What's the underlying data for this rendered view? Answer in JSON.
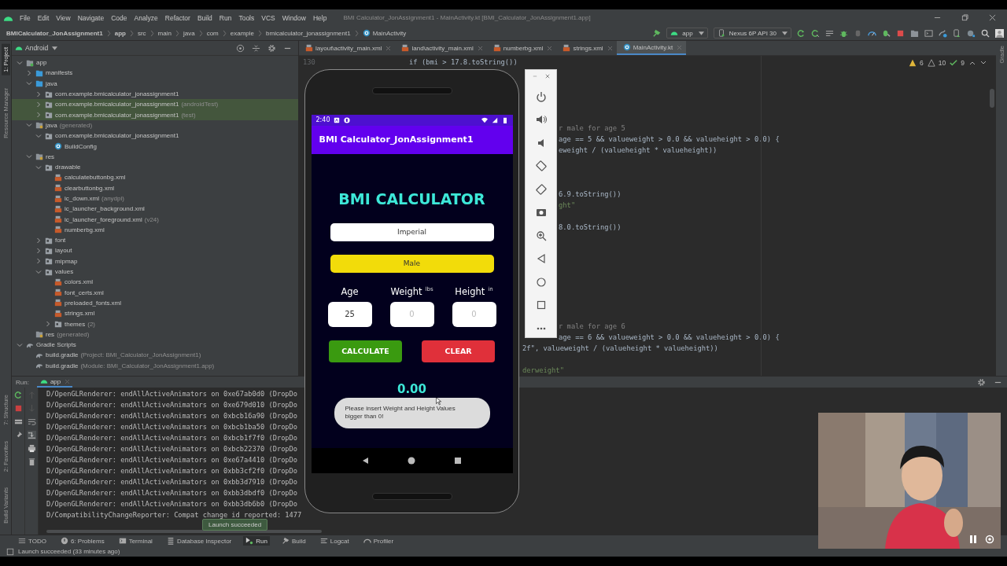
{
  "menu_bar": {
    "items": [
      "File",
      "Edit",
      "View",
      "Navigate",
      "Code",
      "Analyze",
      "Refactor",
      "Build",
      "Run",
      "Tools",
      "VCS",
      "Window",
      "Help"
    ],
    "title": "BMI Calculator_JonAssignment1 - MainActivity.kt [BMI_Calculator_JonAssignment1.app]"
  },
  "nav_bar": {
    "breadcrumbs": [
      {
        "label": "BMICalculator_JonAssignment1",
        "kind": "project"
      },
      {
        "label": "app",
        "kind": "module"
      },
      {
        "label": "src",
        "kind": "dir"
      },
      {
        "label": "main",
        "kind": "dir"
      },
      {
        "label": "java",
        "kind": "dir"
      },
      {
        "label": "com",
        "kind": "dir"
      },
      {
        "label": "example",
        "kind": "dir"
      },
      {
        "label": "bmicalculator_jonassignment1",
        "kind": "dir"
      },
      {
        "label": "MainActivity",
        "kind": "class"
      }
    ],
    "run_config": "app",
    "device": "Nexus 6P API 30"
  },
  "left_tool_strip": {
    "top": [
      {
        "label": "1: Project",
        "selected": true
      },
      {
        "label": "Resource Manager",
        "selected": false
      }
    ],
    "bottom": [
      {
        "label": "7: Structure",
        "selected": false
      },
      {
        "label": "2: Favorites",
        "selected": false
      },
      {
        "label": "Build Variants",
        "selected": false
      }
    ]
  },
  "right_tool_strip": [
    {
      "label": "Gradle",
      "selected": false
    }
  ],
  "project": {
    "view": "Android",
    "tree": [
      {
        "label": "app",
        "kind": "module",
        "expanded": true,
        "selected": false,
        "children": [
          {
            "label": "manifests",
            "kind": "source",
            "expanded": false,
            "selected": false
          },
          {
            "label": "java",
            "kind": "source",
            "expanded": true,
            "selected": false,
            "children": [
              {
                "label": "com.example.bmicalculator_jonassignment1",
                "kind": "package",
                "expanded": false,
                "selected": false
              },
              {
                "label": "com.example.bmicalculator_jonassignment1",
                "note": "(androidTest)",
                "kind": "package",
                "expanded": false,
                "selected": true
              },
              {
                "label": "com.example.bmicalculator_jonassignment1",
                "note": "(test)",
                "kind": "package",
                "expanded": false,
                "selected": true
              }
            ]
          },
          {
            "label": "java",
            "note": "(generated)",
            "kind": "generated",
            "expanded": true,
            "selected": false,
            "children": [
              {
                "label": "com.example.bmicalculator_jonassignment1",
                "kind": "package",
                "expanded": true,
                "selected": false,
                "children": [
                  {
                    "label": "BuildConfig",
                    "kind": "class",
                    "selected": false
                  }
                ]
              }
            ]
          },
          {
            "label": "res",
            "kind": "resources",
            "expanded": true,
            "selected": false,
            "children": [
              {
                "label": "drawable",
                "kind": "package",
                "expanded": true,
                "selected": false,
                "children": [
                  {
                    "label": "calculatebuttonbg.xml",
                    "kind": "xml",
                    "selected": false
                  },
                  {
                    "label": "clearbuttonbg.xml",
                    "kind": "xml",
                    "selected": false
                  },
                  {
                    "label": "ic_down.xml",
                    "note": "(anydpi)",
                    "kind": "xml",
                    "selected": false
                  },
                  {
                    "label": "ic_launcher_background.xml",
                    "kind": "xml",
                    "selected": false
                  },
                  {
                    "label": "ic_launcher_foreground.xml",
                    "note": "(v24)",
                    "kind": "xml",
                    "selected": false
                  },
                  {
                    "label": "numberbg.xml",
                    "kind": "xml",
                    "selected": false
                  }
                ]
              },
              {
                "label": "font",
                "kind": "package",
                "expanded": false,
                "selected": false
              },
              {
                "label": "layout",
                "kind": "package",
                "expanded": false,
                "selected": false
              },
              {
                "label": "mipmap",
                "kind": "package",
                "expanded": false,
                "selected": false
              },
              {
                "label": "values",
                "kind": "package",
                "expanded": true,
                "selected": false,
                "children": [
                  {
                    "label": "colors.xml",
                    "kind": "xml",
                    "selected": false
                  },
                  {
                    "label": "font_certs.xml",
                    "kind": "xml",
                    "selected": false
                  },
                  {
                    "label": "preloaded_fonts.xml",
                    "kind": "xml",
                    "selected": false
                  },
                  {
                    "label": "strings.xml",
                    "kind": "xml",
                    "selected": false
                  },
                  {
                    "label": "themes",
                    "note": "(2)",
                    "kind": "package",
                    "expanded": false,
                    "selected": false
                  }
                ]
              }
            ]
          },
          {
            "label": "res",
            "note": "(generated)",
            "kind": "resources",
            "selected": false
          }
        ]
      },
      {
        "label": "Gradle Scripts",
        "kind": "gradle",
        "expanded": true,
        "selected": false,
        "children": [
          {
            "label": "build.gradle",
            "note": "(Project: BMI_Calculator_JonAssignment1)",
            "kind": "gradle",
            "selected": false
          },
          {
            "label": "build.gradle",
            "note": "(Module: BMI_Calculator_JonAssignment1.app)",
            "kind": "gradle",
            "selected": false
          }
        ]
      }
    ]
  },
  "editor": {
    "tabs": [
      {
        "label": "layout\\activity_main.xml",
        "kind": "xml",
        "selected": false
      },
      {
        "label": "land\\activity_main.xml",
        "kind": "xml",
        "selected": false
      },
      {
        "label": "numberbg.xml",
        "kind": "xml",
        "selected": false
      },
      {
        "label": "strings.xml",
        "kind": "xml",
        "selected": false
      },
      {
        "label": "MainActivity.kt",
        "kind": "kotlin",
        "selected": true
      }
    ],
    "inspections": {
      "warnings": "6",
      "weak_warnings": "10",
      "typos": "9"
    },
    "lines": [
      {
        "number": "130",
        "text": "if (bmi > 17.8.toString())",
        "kind": "code"
      },
      {
        "text": "r male for age 5",
        "kind": "comment"
      },
      {
        "text": "age == 5 && valueweight > 0.0 && valueheight > 0.0) {",
        "kind": "code"
      },
      {
        "text": "eweight / (valueheight * valueheight))",
        "kind": "code"
      },
      {
        "text": "6.9.toString())",
        "kind": "code"
      },
      {
        "text": "ght\"",
        "kind": "string"
      },
      {
        "text": "8.0.toString())",
        "kind": "code"
      },
      {
        "text": "r male for age 6",
        "kind": "comment"
      },
      {
        "text": "age == 6 && valueweight > 0.0 && valueheight > 0.0) {",
        "kind": "code"
      },
      {
        "text": "2f\", valueweight / (valueheight * valueheight))",
        "kind": "code"
      },
      {
        "text": "derweight\"",
        "kind": "string"
      }
    ]
  },
  "phone": {
    "status_time": "2:40",
    "app_title": "BMI Calculator_JonAssignment1",
    "heading": "BMI CALCULATOR",
    "unit_spinner": "Imperial",
    "gender_spinner": "Male",
    "inputs": [
      {
        "label": "Age",
        "value": "25"
      },
      {
        "label": "Weight",
        "unit": "lbs",
        "placeholder": "0"
      },
      {
        "label": "Height",
        "unit": "in",
        "placeholder": "0"
      }
    ],
    "buttons": [
      {
        "label": "CALCULATE",
        "kind": "calculate"
      },
      {
        "label": "CLEAR",
        "kind": "clear"
      }
    ],
    "result": "0.00",
    "toast": "Please insert Weight and Height Values bigger than 0!"
  },
  "run": {
    "label": "Run:",
    "tab": "app",
    "lines": [
      "D/OpenGLRenderer: endAllActiveAnimators on 0xe67ab0d0 (DropDo",
      "D/OpenGLRenderer: endAllActiveAnimators on 0xe679d010 (DropDo",
      "D/OpenGLRenderer: endAllActiveAnimators on 0xbcb16a90 (DropDo",
      "D/OpenGLRenderer: endAllActiveAnimators on 0xbcb1ba50 (DropDo",
      "D/OpenGLRenderer: endAllActiveAnimators on 0xbcb1f7f0 (DropDo",
      "D/OpenGLRenderer: endAllActiveAnimators on 0xbcb22370 (DropDo",
      "D/OpenGLRenderer: endAllActiveAnimators on 0xe67a4410 (DropDo",
      "D/OpenGLRenderer: endAllActiveAnimators on 0xbb3cf2f0 (DropDo",
      "D/OpenGLRenderer: endAllActiveAnimators on 0xbb3d7910 (DropDo",
      "D/OpenGLRenderer: endAllActiveAnimators on 0xbb3dbdf0 (DropDo",
      "D/OpenGLRenderer: endAllActiveAnimators on 0xbb3db6b0 (DropDo",
      "D/CompatibilityChangeReporter: Compat change id reported: 1477"
    ]
  },
  "tool_windows": [
    {
      "label": "TODO",
      "kind": "list",
      "selected": false
    },
    {
      "label": "6: Problems",
      "kind": "problems",
      "selected": false
    },
    {
      "label": "Terminal",
      "kind": "terminal",
      "selected": false
    },
    {
      "label": "Database Inspector",
      "kind": "database",
      "selected": false
    },
    {
      "label": "Run",
      "kind": "run",
      "selected": true
    },
    {
      "label": "Build",
      "kind": "build",
      "selected": false
    },
    {
      "label": "Logcat",
      "kind": "logcat",
      "selected": false
    },
    {
      "label": "Profiler",
      "kind": "profiler",
      "selected": false
    }
  ],
  "tooltip": "Launch succeeded",
  "status_bar": {
    "message": "Launch succeeded (33 minutes ago)"
  }
}
